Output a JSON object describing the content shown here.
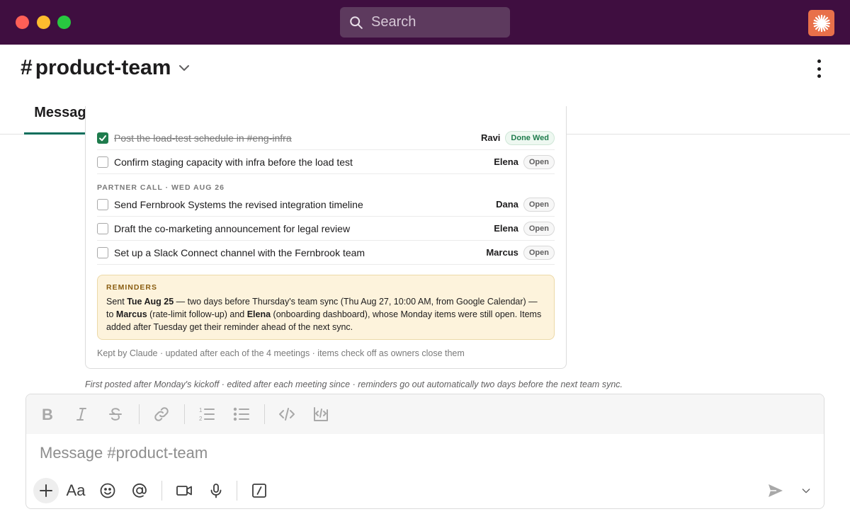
{
  "search": {
    "placeholder": "Search"
  },
  "channel": {
    "hash": "#",
    "name": "product-team"
  },
  "tabs": [
    {
      "label": "Messages"
    }
  ],
  "tasks_top": [
    {
      "text": "Post the load-test schedule in #eng-infra",
      "owner": "Ravi",
      "status": "Done Wed",
      "done": true
    },
    {
      "text": "Confirm staging capacity with infra before the load test",
      "owner": "Elena",
      "status": "Open",
      "done": false
    }
  ],
  "partner_call": {
    "label": "PARTNER CALL · WED AUG 26",
    "tasks": [
      {
        "text": "Send Fernbrook Systems the revised integration timeline",
        "owner": "Dana",
        "status": "Open",
        "done": false
      },
      {
        "text": "Draft the co-marketing announcement for legal review",
        "owner": "Elena",
        "status": "Open",
        "done": false
      },
      {
        "text": "Set up a Slack Connect channel with the Fernbrook team",
        "owner": "Marcus",
        "status": "Open",
        "done": false
      }
    ]
  },
  "reminders": {
    "label": "REMINDERS",
    "t1": "Sent ",
    "b1": "Tue Aug 25",
    "t2": " — two days before Thursday's team sync (Thu Aug 27, 10:00 AM, from Google Calendar) — to ",
    "b2": "Marcus",
    "t3": " (rate-limit follow-up) and ",
    "b3": "Elena",
    "t4": " (onboarding dashboard), whose Monday items were still open. Items added after Tuesday get their reminder ahead of the next sync."
  },
  "card_footer": "Kept by Claude · updated after each of the 4 meetings · items check off as owners close them",
  "post_note": "First posted after Monday's kickoff · edited after each meeting since · reminders go out automatically two days before the next team sync.",
  "composer": {
    "placeholder": "Message #product-team",
    "aa_label": "Aa"
  },
  "colors": {
    "titlebar": "#3f0e40",
    "tab_underline": "#0b6e5c",
    "done_green": "#1f7c4d",
    "reminder_bg": "#fdf3dc"
  }
}
